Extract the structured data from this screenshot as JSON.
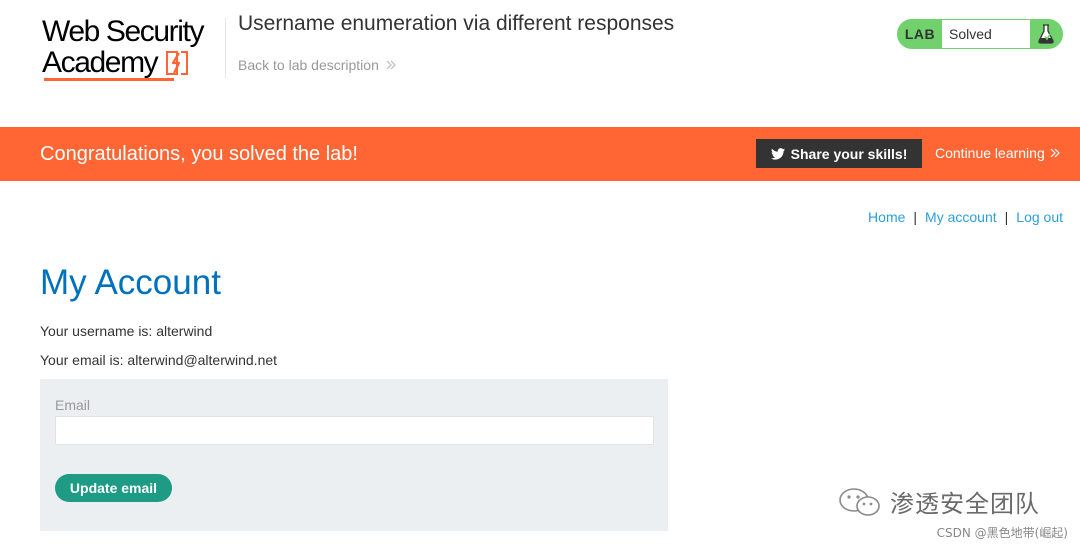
{
  "header": {
    "logo_line1": "Web Security",
    "logo_line2": "Academy",
    "lab_title": "Username enumeration via different responses",
    "back_link": "Back to lab description",
    "status_lab": "LAB",
    "status_state": "Solved"
  },
  "banner": {
    "message": "Congratulations, you solved the lab!",
    "share_label": "Share your skills!",
    "continue_label": "Continue learning"
  },
  "nav": {
    "home": "Home",
    "separator": "|",
    "my_account": "My account",
    "logout": "Log out"
  },
  "account": {
    "title": "My Account",
    "username_line": "Your username is: alterwind",
    "email_line": "Your email is: alterwind@alterwind.net",
    "email_label": "Email",
    "email_value": "",
    "update_button": "Update email"
  },
  "watermark": {
    "team": "渗透安全团队",
    "csdn": "CSDN @黑色地带(崛起)"
  },
  "colors": {
    "accent_orange": "#ff6633",
    "status_green": "#70d16d",
    "title_blue": "#0071bc",
    "link_blue": "#2ba0d8",
    "button_teal": "#1d9b85"
  },
  "icons": {
    "logo": "lightning-bolt-icon",
    "back_chevron": "double-chevron-right-icon",
    "flask": "flask-icon",
    "share": "twitter-icon",
    "continue_chevron": "double-chevron-right-icon",
    "watermark": "wechat-icon"
  }
}
